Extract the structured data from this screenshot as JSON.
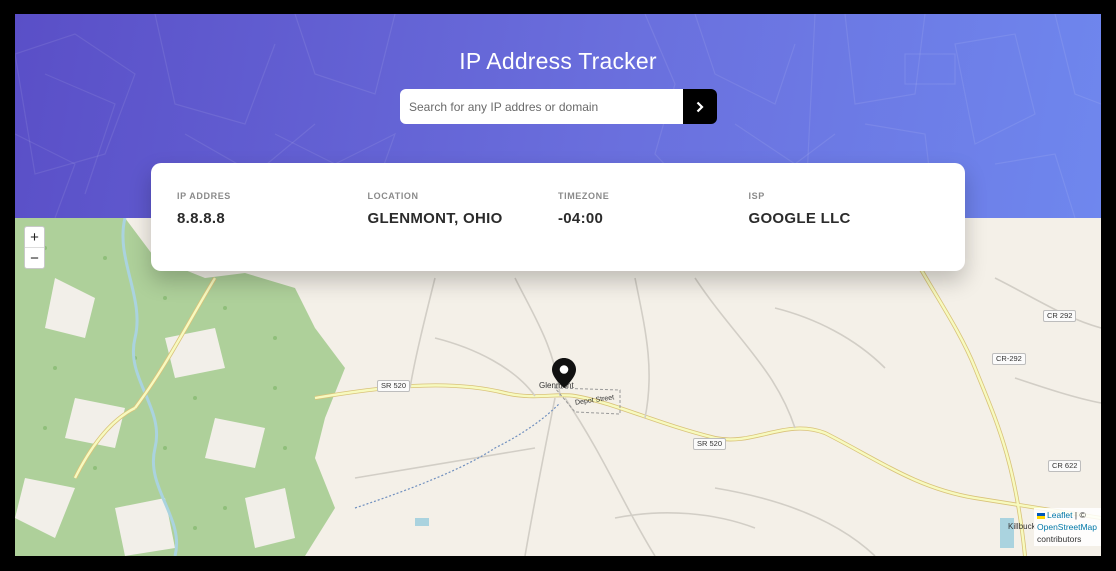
{
  "header": {
    "title": "IP Address Tracker",
    "search_placeholder": "Search for any IP addres or domain"
  },
  "icons": {
    "submit": "chevron-right-icon",
    "marker": "location-pin-icon"
  },
  "info": [
    {
      "label": "IP ADDRES",
      "value": "8.8.8.8"
    },
    {
      "label": "LOCATION",
      "value": "GLENMONT, OHIO"
    },
    {
      "label": "TIMEZONE",
      "value": "-04:00"
    },
    {
      "label": "ISP",
      "value": "GOOGLE LLC"
    }
  ],
  "map": {
    "zoom_in": "+",
    "zoom_out": "−",
    "place_labels": {
      "town": "Glenmont",
      "street": "Depot Street",
      "city_right": "Killbuck"
    },
    "road_shields": {
      "sr520_a": "SR 520",
      "sr520_b": "SR 520",
      "cr292_a": "CR 292",
      "cr292_b": "CR-292",
      "cr622": "CR 622"
    },
    "attribution": {
      "leaflet": "Leaflet",
      "sep": " | © ",
      "osm": "OpenStreetMap",
      "tail": " contributors"
    }
  },
  "colors": {
    "header_start": "#5a4fc7",
    "header_end": "#6f87ee",
    "forest": "#aed09a",
    "road": "#f7fabf",
    "water": "#aad3df"
  }
}
